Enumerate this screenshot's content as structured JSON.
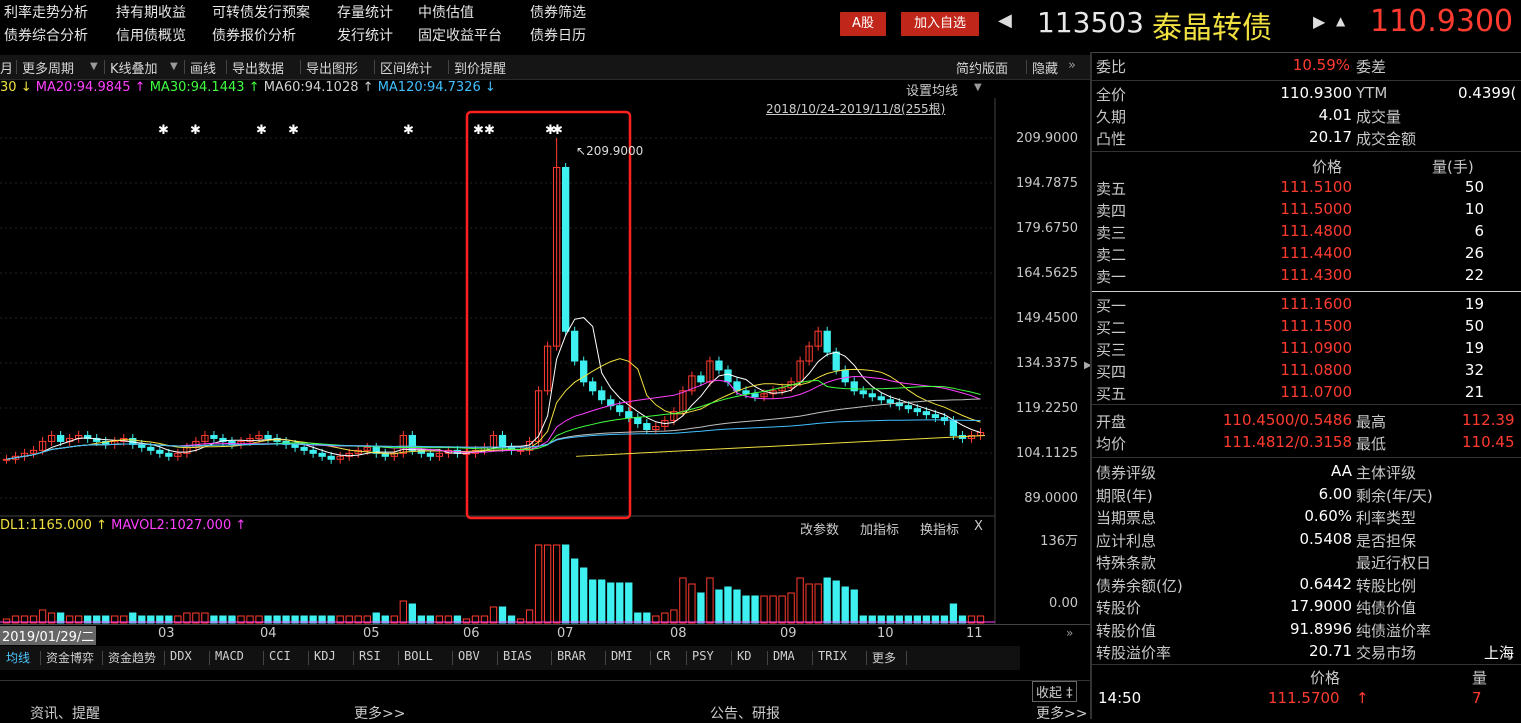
{
  "topnav": {
    "row1": [
      "利率走势分析",
      "持有期收益",
      "可转债发行预案",
      "存量统计",
      "中债估值",
      "债券筛选"
    ],
    "row2": [
      "债券综合分析",
      "信用债概览",
      "债券报价分析",
      "发行统计",
      "固定收益平台",
      "债券日历"
    ],
    "btn_a": "A股",
    "btn_watch": "加入自选",
    "code": "113503",
    "name": "泰晶转债",
    "price": "110.9300"
  },
  "toolbar": {
    "items": [
      "月",
      "更多周期",
      "K线叠加",
      "画线",
      "导出数据",
      "导出图形",
      "区间统计",
      "到价提醒"
    ],
    "right": [
      "简约版面",
      "隐藏"
    ],
    "set_ma": "设置均线",
    "date_range": "2018/10/24-2019/11/8(255根)"
  },
  "ma_legend": {
    "ma10": "30",
    "ma20": "MA20:94.9845",
    "ma30": "MA30:94.1443",
    "ma60": "MA60:94.1028",
    "ma120": "MA120:94.7326"
  },
  "yaxis": [
    "209.9000",
    "194.7875",
    "179.6750",
    "164.5625",
    "149.4500",
    "134.3375",
    "119.2250",
    "104.1125",
    "89.0000"
  ],
  "peak_label": "209.9000",
  "vol_legend": {
    "vol1": "DL1:1165.000",
    "vol2": "MAVOL2:1027.000",
    "buttons": [
      "改参数",
      "加指标",
      "换指标"
    ],
    "close": "X",
    "ymax": "136万",
    "ymin": "0.00"
  },
  "xaxis": {
    "current": "2019/01/29/二",
    "months": [
      "03",
      "04",
      "05",
      "06",
      "07",
      "08",
      "09",
      "10",
      "11"
    ]
  },
  "bottom_tabs": [
    "均线",
    "资金博弈",
    "资金趋势",
    "DDX",
    "MACD",
    "CCI",
    "KDJ",
    "RSI",
    "BOLL",
    "OBV",
    "BIAS",
    "BRAR",
    "DMI",
    "CR",
    "PSY",
    "KD",
    "DMA",
    "TRIX",
    "更多"
  ],
  "bottom_bar": {
    "left": "资讯、提醒",
    "more1": "更多>>",
    "center": "公告、研报",
    "more2": "更多>>",
    "collapse": "收起"
  },
  "right": {
    "weibi_label": "委比",
    "weibi": "10.59%",
    "weicha_label": "委差",
    "quanjia_label": "全价",
    "quanjia": "110.9300",
    "ytm_label": "YTM",
    "ytm": "0.4399(",
    "jiuqi_label": "久期",
    "jiuqi": "4.01",
    "chengjiaoliang_label": "成交量",
    "tuxing_label": "凸性",
    "tuxing": "20.17",
    "chengjiaoe_label": "成交金额",
    "book_price_header": "价格",
    "book_qty_header": "量(手)",
    "asks": [
      {
        "label": "卖五",
        "price": "111.5100",
        "qty": "50"
      },
      {
        "label": "卖四",
        "price": "111.5000",
        "qty": "10"
      },
      {
        "label": "卖三",
        "price": "111.4800",
        "qty": "6"
      },
      {
        "label": "卖二",
        "price": "111.4400",
        "qty": "26"
      },
      {
        "label": "卖一",
        "price": "111.4300",
        "qty": "22"
      }
    ],
    "bids": [
      {
        "label": "买一",
        "price": "111.1600",
        "qty": "19"
      },
      {
        "label": "买二",
        "price": "111.1500",
        "qty": "50"
      },
      {
        "label": "买三",
        "price": "111.0900",
        "qty": "19"
      },
      {
        "label": "买四",
        "price": "111.0800",
        "qty": "32"
      },
      {
        "label": "买五",
        "price": "111.0700",
        "qty": "21"
      }
    ],
    "kaipan_label": "开盘",
    "kaipan": "110.4500/0.5486",
    "zuigao_label": "最高",
    "zuigao": "112.39",
    "junjia_label": "均价",
    "junjia": "111.4812/0.3158",
    "zuidi_label": "最低",
    "zuidi": "110.45",
    "info": [
      {
        "l1": "债券评级",
        "v1": "AA",
        "l2": "主体评级"
      },
      {
        "l1": "期限(年)",
        "v1": "6.00",
        "l2": "剩余(年/天)"
      },
      {
        "l1": "当期票息",
        "v1": "0.60%",
        "l2": "利率类型"
      },
      {
        "l1": "应计利息",
        "v1": "0.5408",
        "l2": "是否担保"
      },
      {
        "l1": "特殊条款",
        "v1": "",
        "l2": "最近行权日"
      },
      {
        "l1": "债券余额(亿)",
        "v1": "0.6442",
        "l2": "转股比例"
      },
      {
        "l1": "转股价",
        "v1": "17.9000",
        "l2": "纯债价值"
      },
      {
        "l1": "转股价值",
        "v1": "91.8996",
        "l2": "纯债溢价率"
      },
      {
        "l1": "转股溢价率",
        "v1": "20.71",
        "l2": "交易市场",
        "v2": "上海"
      }
    ],
    "ticks_price_header": "价格",
    "ticks_qty_header": "量",
    "tick_time": "14:50",
    "tick_price": "111.5700",
    "tick_qty": "7"
  },
  "colors": {
    "up": "#ff3b30",
    "down": "#3ef0f0",
    "ma5": "#ffffff",
    "ma10": "#f0e040",
    "ma20": "#ff40ff",
    "ma30": "#40ff40",
    "ma60": "#c0c0c0",
    "ma120": "#40c0ff",
    "highlight": "#ff2020"
  },
  "chart_data": {
    "type": "candlestick",
    "ylim": [
      89.0,
      209.9
    ],
    "months": [
      "03",
      "04",
      "05",
      "06",
      "07",
      "08",
      "09",
      "10",
      "11"
    ],
    "close_approx": [
      102,
      103,
      104,
      105,
      108,
      110,
      108,
      109,
      110,
      109,
      108,
      107,
      108,
      109,
      107,
      106,
      105,
      104,
      103,
      104,
      106,
      108,
      110,
      109,
      108,
      107,
      108,
      109,
      110,
      109,
      108,
      107,
      106,
      105,
      104,
      103,
      102,
      103,
      104,
      105,
      106,
      104,
      103,
      104,
      110,
      105,
      104,
      103,
      104,
      105,
      104,
      104,
      105,
      106,
      110,
      106,
      105,
      105,
      108,
      125,
      140,
      200,
      145,
      135,
      128,
      125,
      122,
      120,
      118,
      116,
      114,
      112,
      113,
      115,
      118,
      125,
      130,
      128,
      135,
      132,
      128,
      125,
      124,
      123,
      124,
      125,
      126,
      128,
      135,
      140,
      145,
      138,
      132,
      128,
      125,
      124,
      123,
      122,
      121,
      120,
      119,
      118,
      117,
      116,
      115,
      110,
      109,
      110,
      111
    ]
  }
}
